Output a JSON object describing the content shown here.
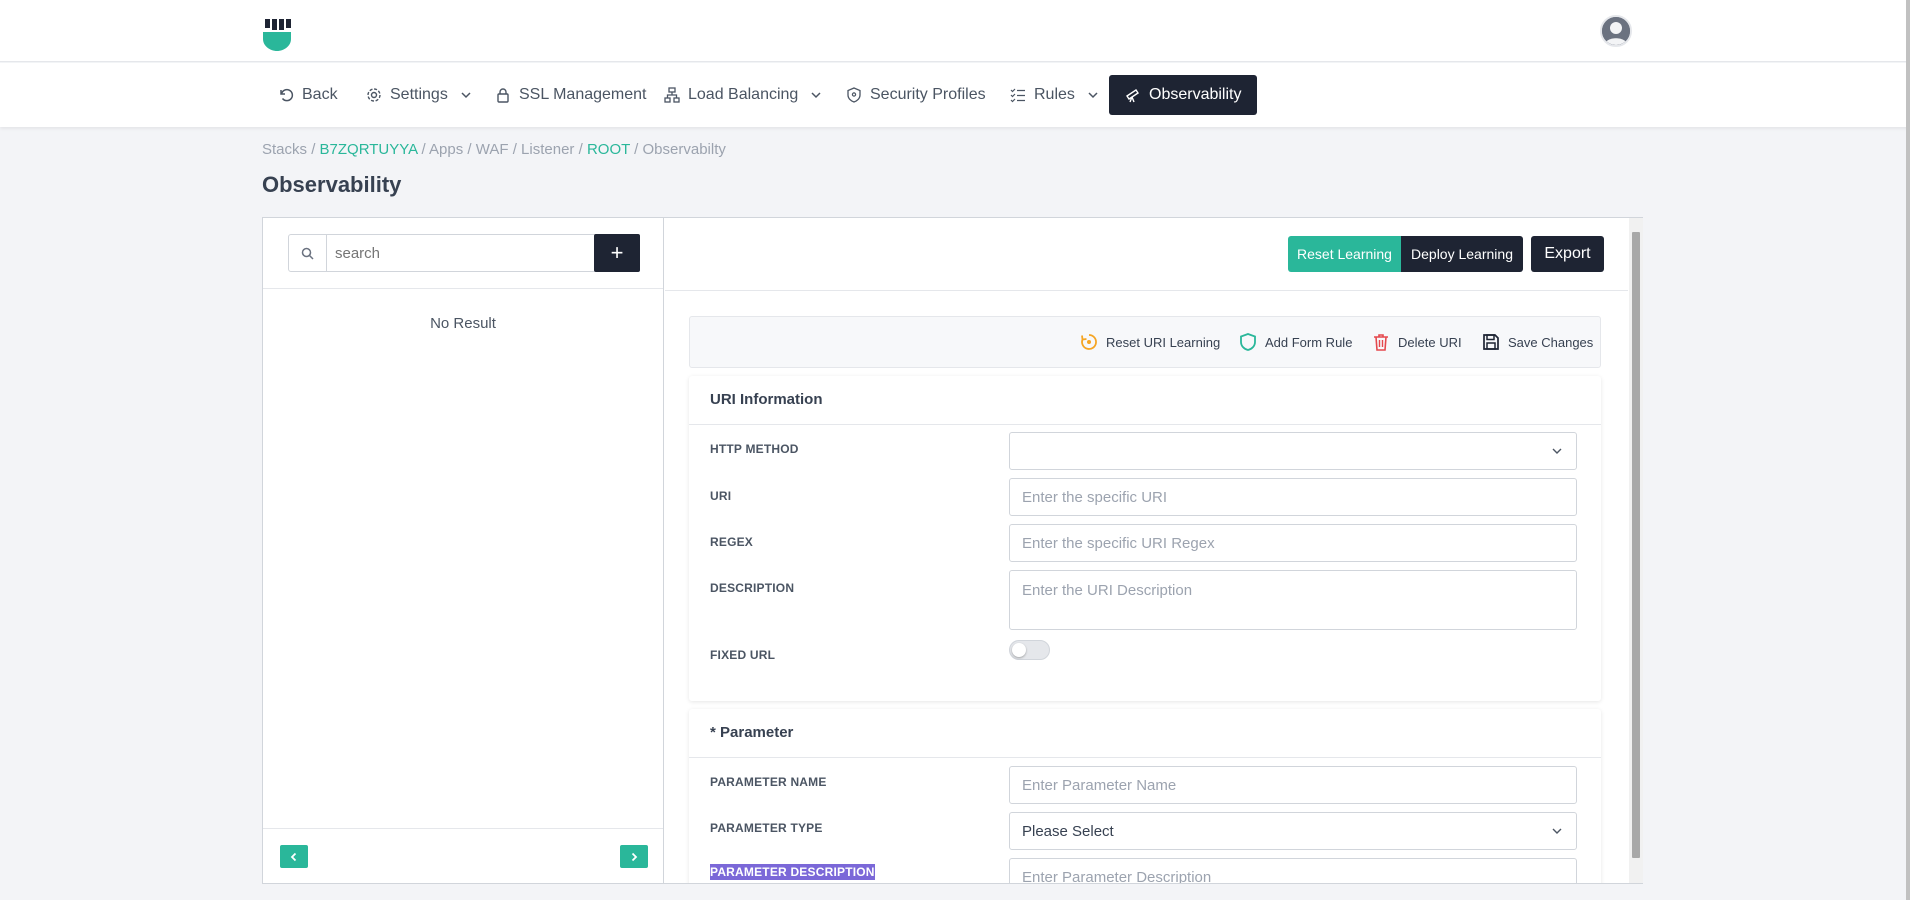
{
  "nav": {
    "back": "Back",
    "settings": "Settings",
    "ssl": "SSL Management",
    "load_balancing": "Load Balancing",
    "security_profiles": "Security Profiles",
    "rules": "Rules",
    "observability": "Observability"
  },
  "breadcrumb": {
    "stacks": "Stacks",
    "sep": "/",
    "stack_id": "B7ZQRTUYYA",
    "apps": "Apps",
    "waf": "WAF",
    "listener": "Listener",
    "root": "ROOT",
    "current": "Observabilty"
  },
  "page_title": "Observability",
  "left": {
    "search_placeholder": "search",
    "add_label": "+",
    "no_result": "No Result"
  },
  "actions": {
    "reset_learning": "Reset Learning",
    "deploy_learning": "Deploy Learning",
    "export": "Export"
  },
  "toolbar": {
    "reset_uri_learning": "Reset URI Learning",
    "add_form_rule": "Add Form Rule",
    "delete_uri": "Delete URI",
    "save_changes": "Save Changes"
  },
  "uri_info": {
    "title": "URI Information",
    "http_method_label": "HTTP METHOD",
    "http_method_value": "",
    "uri_label": "URI",
    "uri_placeholder": "Enter the specific URI",
    "regex_label": "REGEX",
    "regex_placeholder": "Enter the specific URI Regex",
    "description_label": "DESCRIPTION",
    "description_placeholder": "Enter the URI Description",
    "fixed_url_label": "FIXED URL"
  },
  "parameter": {
    "title": "* Parameter",
    "name_label": "PARAMETER NAME",
    "name_placeholder": "Enter Parameter Name",
    "type_label": "PARAMETER TYPE",
    "type_value": "Please Select",
    "description_label": "PARAMETER DESCRIPTION",
    "description_placeholder": "Enter Parameter Description"
  },
  "colors": {
    "accent": "#2ab79a",
    "dark": "#1e2433"
  },
  "icons": [
    "logo-icon",
    "avatar-icon",
    "back-icon",
    "gear-icon",
    "lock-icon",
    "network-icon",
    "shield-icon",
    "rules-icon",
    "telescope-icon",
    "search-icon",
    "chevron-left-icon",
    "chevron-right-icon",
    "reset-icon",
    "shield-check-icon",
    "trash-icon",
    "save-icon",
    "chevron-down-icon"
  ]
}
